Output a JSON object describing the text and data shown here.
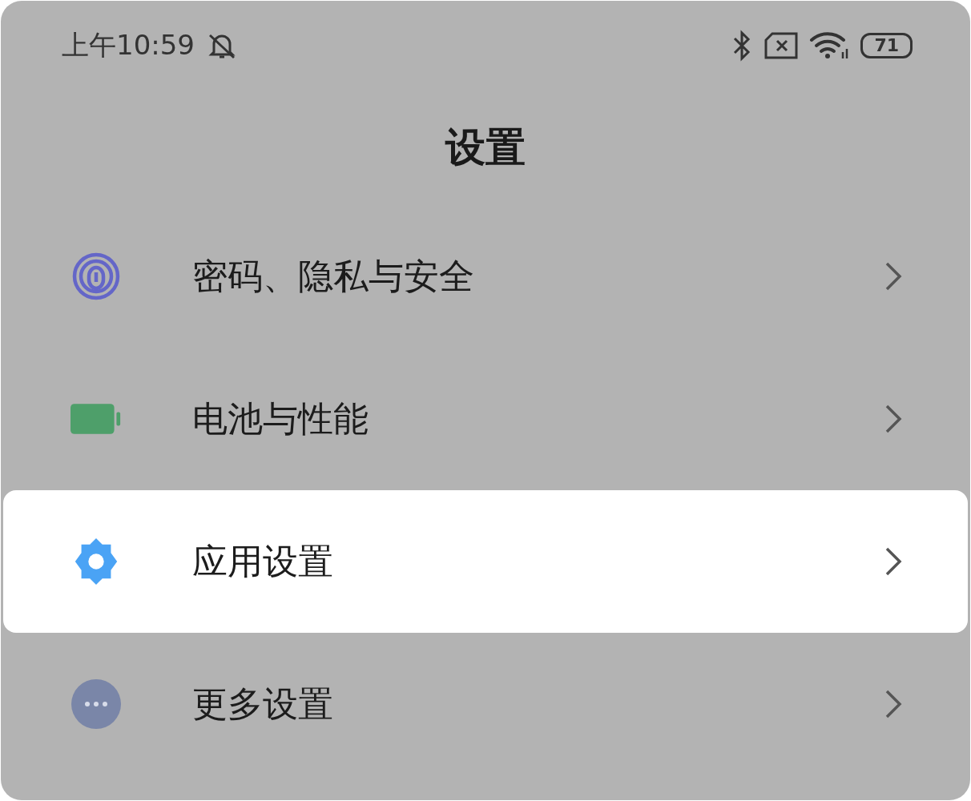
{
  "status_bar": {
    "time": "上午10:59",
    "battery": "71"
  },
  "title": "设置",
  "items": [
    {
      "kind": "fingerprint",
      "label": "密码、隐私与安全",
      "selected": false
    },
    {
      "kind": "battery",
      "label": "电池与性能",
      "selected": false
    },
    {
      "kind": "gear",
      "label": "应用设置",
      "selected": true
    },
    {
      "kind": "more",
      "label": "更多设置",
      "selected": false
    }
  ]
}
